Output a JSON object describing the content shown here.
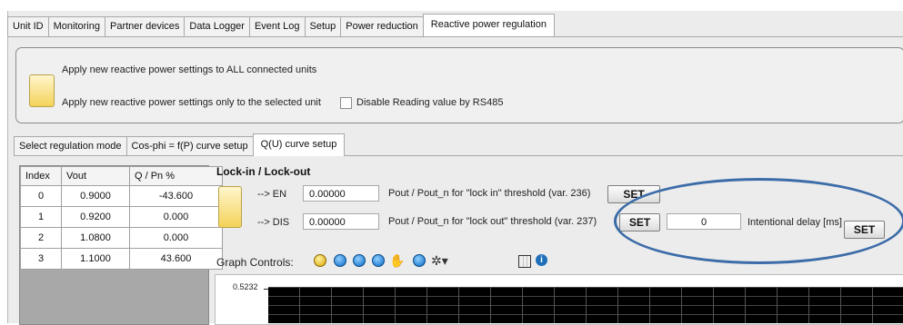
{
  "main_tabs": [
    {
      "label": "Unit ID"
    },
    {
      "label": "Monitoring"
    },
    {
      "label": "Partner devices"
    },
    {
      "label": "Data Logger"
    },
    {
      "label": "Event Log"
    },
    {
      "label": "Setup"
    },
    {
      "label": "Power reduction"
    },
    {
      "label": "Reactive power regulation"
    }
  ],
  "apply": {
    "all_label": "Apply new reactive power settings to ALL connected units",
    "selected_label": "Apply new reactive power settings only to the selected unit",
    "disable_rs485_label": "Disable Reading value by RS485"
  },
  "sub_tabs": [
    {
      "label": "Select regulation mode"
    },
    {
      "label": "Cos-phi = f(P) curve setup"
    },
    {
      "label": "Q(U) curve setup"
    }
  ],
  "table": {
    "headers": [
      "Index",
      "Vout",
      "Q / Pn %"
    ],
    "rows": [
      [
        "0",
        "0.9000",
        "-43.600"
      ],
      [
        "1",
        "0.9200",
        "0.000"
      ],
      [
        "2",
        "1.0800",
        "0.000"
      ],
      [
        "3",
        "1.1000",
        "43.600"
      ]
    ]
  },
  "lock": {
    "title": "Lock-in / Lock-out",
    "en_label": "--> EN",
    "en_value": "0.00000",
    "en_desc": "Pout / Pout_n for \"lock in\" threshold (var. 236)",
    "dis_label": "--> DIS",
    "dis_value": "0.00000",
    "dis_desc": "Pout / Pout_n for \"lock out\" threshold (var. 237)",
    "set_label": "SET",
    "delay_value": "0",
    "delay_label": "Intentional delay [ms]"
  },
  "graph": {
    "controls_label": "Graph Controls:",
    "y_top": "0.5232"
  },
  "colors": {
    "annotation_ellipse": "#3c6ca8",
    "plot_background": "#000000",
    "icon_yellow": "#f4d25a"
  }
}
